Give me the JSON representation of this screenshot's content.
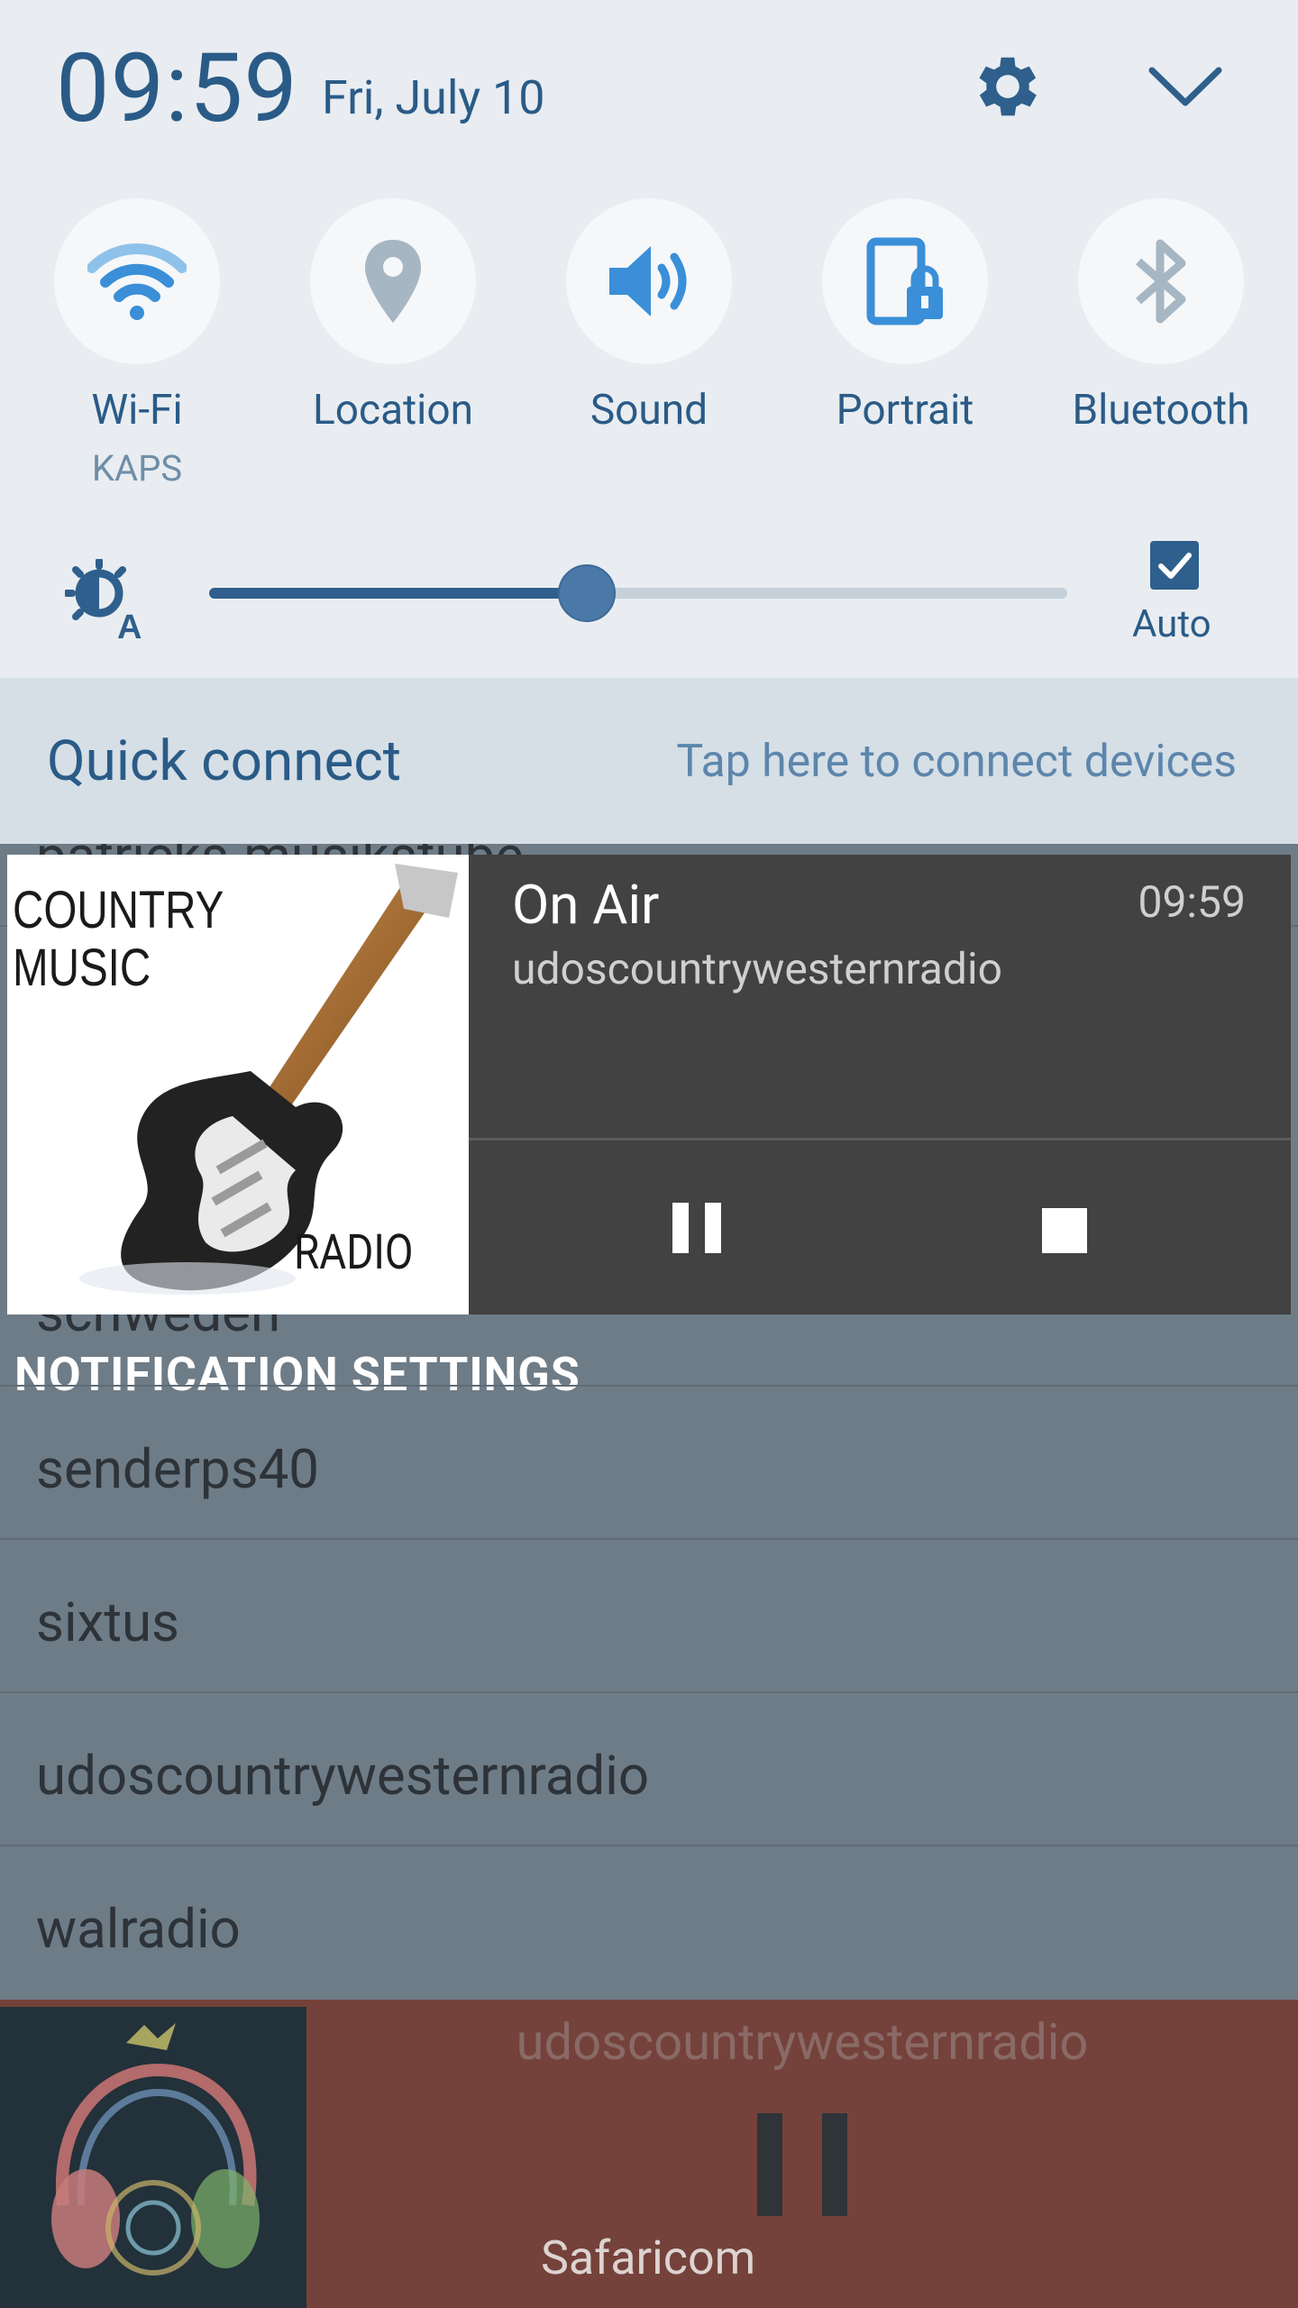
{
  "status": {
    "time": "09:59",
    "date": "Fri, July 10"
  },
  "quick_settings": {
    "tiles": [
      {
        "label": "Wi-Fi",
        "sublabel": "KAPS",
        "icon": "wifi-icon"
      },
      {
        "label": "Location",
        "sublabel": "",
        "icon": "location-icon"
      },
      {
        "label": "Sound",
        "sublabel": "",
        "icon": "sound-icon"
      },
      {
        "label": "Portrait",
        "sublabel": "",
        "icon": "portrait-lock-icon"
      },
      {
        "label": "Bluetooth",
        "sublabel": "",
        "icon": "bluetooth-icon"
      }
    ],
    "brightness": {
      "level": 0.44,
      "auto_label": "Auto",
      "auto_checked": true
    }
  },
  "quick_connect": {
    "title": "Quick connect",
    "hint": "Tap here to connect devices"
  },
  "media_notification": {
    "title": "On Air",
    "subtitle": "udoscountrywesternradio",
    "time": "09:59",
    "art_text_top": "COUNTRY\nMUSIC",
    "art_text_bottom": "RADIO"
  },
  "background_list": {
    "partial_top": "patricks-musikstube",
    "partial_bottom": "schweden",
    "section_header": "NOTIFICATION SETTINGS",
    "items": [
      "senderps40",
      "sixtus",
      "udoscountrywesternradio",
      "walradio"
    ]
  },
  "player": {
    "station": "udoscountrywesternradio",
    "carrier": "Safaricom"
  },
  "colors": {
    "accent": "#2a5b87",
    "panel": "#e9edf1",
    "player_bg": "#74423b"
  }
}
